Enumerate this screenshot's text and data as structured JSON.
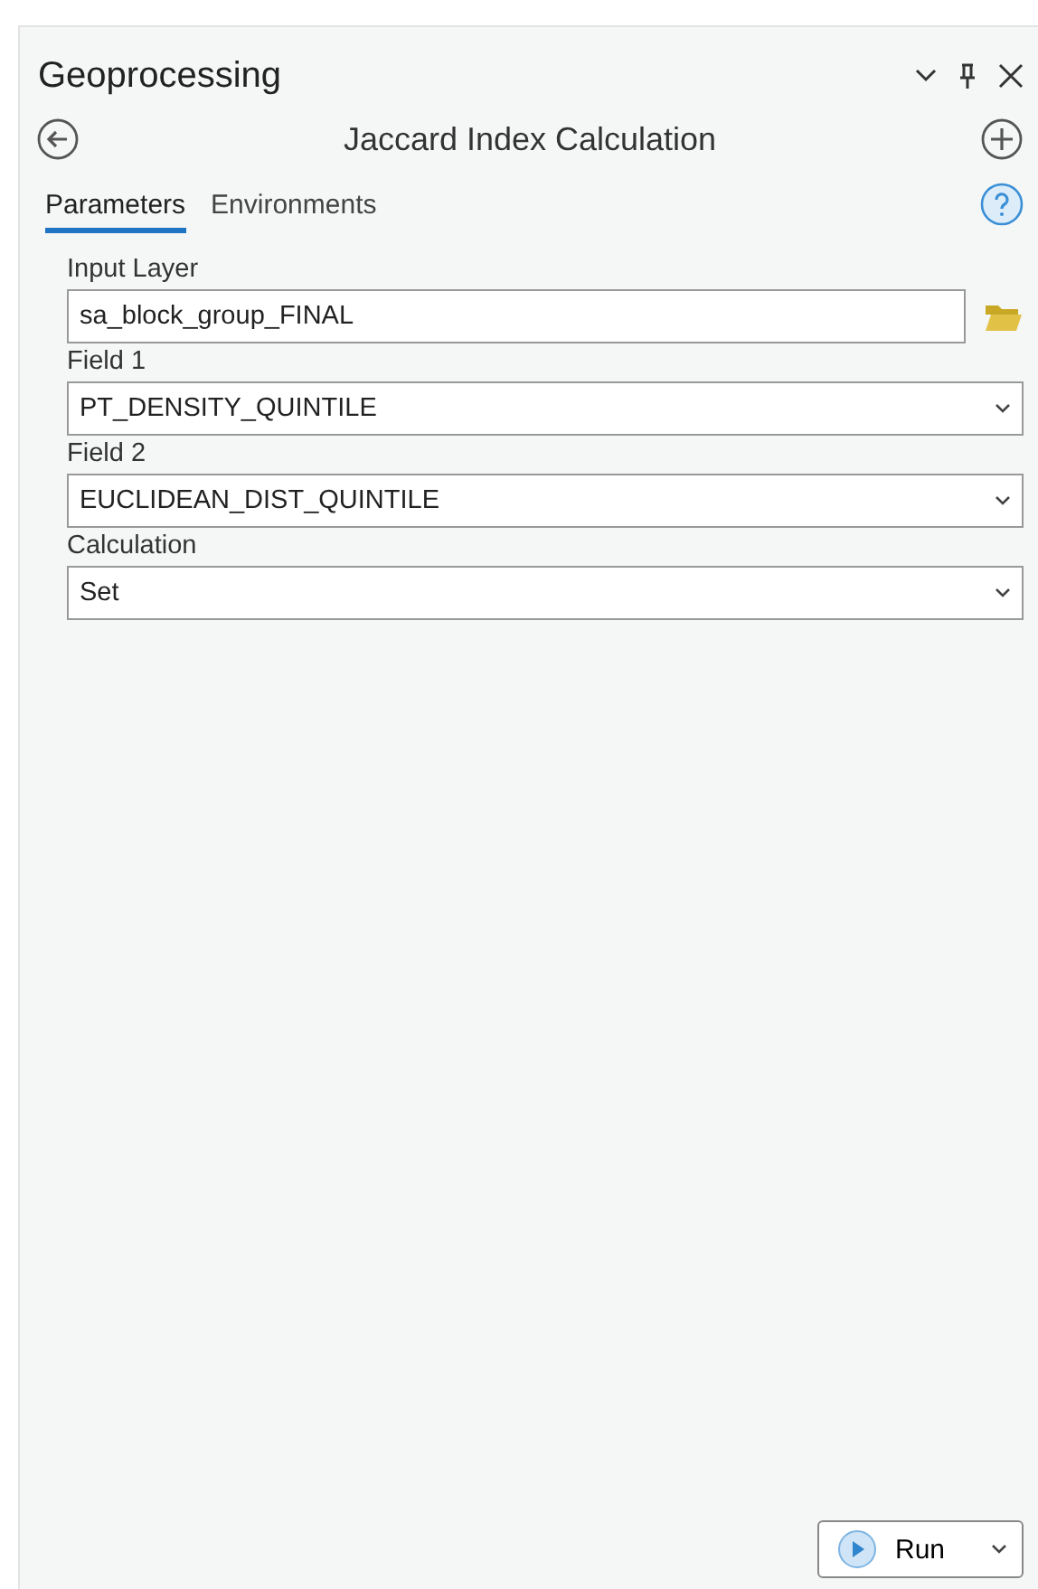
{
  "pane": {
    "title": "Geoprocessing"
  },
  "tool": {
    "title": "Jaccard Index Calculation"
  },
  "tabs": [
    {
      "label": "Parameters",
      "selected": true
    },
    {
      "label": "Environments",
      "selected": false
    }
  ],
  "parameters": [
    {
      "label": "Input Layer",
      "kind": "layer",
      "value": "sa_block_group_FINAL"
    },
    {
      "label": "Field 1",
      "kind": "dropdown",
      "value": "PT_DENSITY_QUINTILE"
    },
    {
      "label": "Field 2",
      "kind": "dropdown",
      "value": "EUCLIDEAN_DIST_QUINTILE"
    },
    {
      "label": "Calculation",
      "kind": "dropdown",
      "value": "Set"
    }
  ],
  "run_button": {
    "label": "Run"
  }
}
